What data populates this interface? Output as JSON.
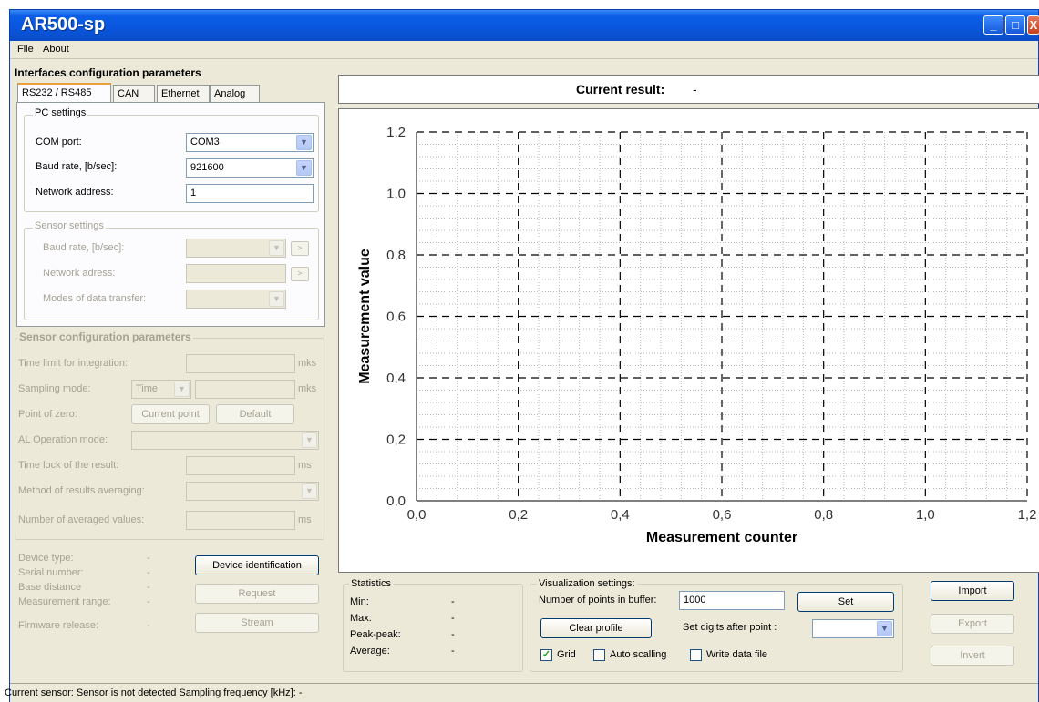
{
  "window": {
    "title": "AR500-sp",
    "controls": {
      "minimize": "_",
      "maximize": "□",
      "close": "X"
    }
  },
  "menu": {
    "file": "File",
    "about": "About"
  },
  "interfaces": {
    "heading": "Interfaces configuration parameters",
    "tabs": [
      "RS232 / RS485",
      "CAN",
      "Ethernet",
      "Analog"
    ],
    "pc_settings": {
      "title": "PC settings",
      "com_port_label": "COM port:",
      "com_port_value": "COM3",
      "baud_label": "Baud rate, [b/sec]:",
      "baud_value": "921600",
      "address_label": "Network address:",
      "address_value": "1"
    },
    "sensor_settings": {
      "title": "Sensor settings",
      "baud_label": "Baud rate, [b/sec]:",
      "address_label": "Network adress:",
      "modes_label": "Modes of data transfer:"
    }
  },
  "sensor_config": {
    "title": "Sensor configuration parameters",
    "time_limit_label": "Time limit for integration:",
    "time_limit_unit": "mks",
    "sampling_label": "Sampling mode:",
    "sampling_value": "Time",
    "sampling_unit": "mks",
    "zero_label": "Point of zero:",
    "current_point_btn": "Current point",
    "default_btn": "Default",
    "al_label": "AL Operation mode:",
    "time_lock_label": "Time lock of the result:",
    "time_lock_unit": "ms",
    "averaging_label": "Method of results averaging:",
    "averaged_label": "Number of averaged values:",
    "averaged_unit": "ms"
  },
  "device": {
    "type_label": "Device type:",
    "type_value": "-",
    "serial_label": "Serial number:",
    "serial_value": "-",
    "base_label": "Base distance",
    "base_value": "-",
    "range_label": "Measurement range:",
    "range_value": "-",
    "firmware_label": "Firmware release:",
    "firmware_value": "-",
    "identify_btn": "Device identification",
    "request_btn": "Request",
    "stream_btn": "Stream"
  },
  "result": {
    "label": "Current result:",
    "value": "-"
  },
  "chart_data": {
    "type": "line",
    "title": "",
    "xlabel": "Measurement counter",
    "ylabel": "Measurement value",
    "xlim": [
      0,
      1.2
    ],
    "ylim": [
      0,
      1.2
    ],
    "x_ticks": [
      "0,0",
      "0,2",
      "0,4",
      "0,6",
      "0,8",
      "1,0",
      "1,2"
    ],
    "y_ticks": [
      "0,0",
      "0,2",
      "0,4",
      "0,6",
      "0,8",
      "1,0",
      "1,2"
    ],
    "grid": true,
    "series": []
  },
  "statistics": {
    "title": "Statistics",
    "min_label": "Min:",
    "min_value": "-",
    "max_label": "Max:",
    "max_value": "-",
    "pp_label": "Peak-peak:",
    "pp_value": "-",
    "avg_label": "Average:",
    "avg_value": "-"
  },
  "visualization": {
    "title": "Visualization settings:",
    "points_label": "Number of points in buffer:",
    "points_value": "1000",
    "set_btn": "Set",
    "clear_btn": "Clear profile",
    "digits_label": "Set digits after point :",
    "grid_label": "Grid",
    "grid_checked": "✓",
    "auto_label": "Auto scalling",
    "write_label": "Write data file"
  },
  "actions": {
    "import": "Import",
    "export": "Export",
    "invert": "Invert"
  },
  "status": {
    "text": "Current sensor: Sensor is not detected  Sampling frequency [kHz]:  -"
  }
}
